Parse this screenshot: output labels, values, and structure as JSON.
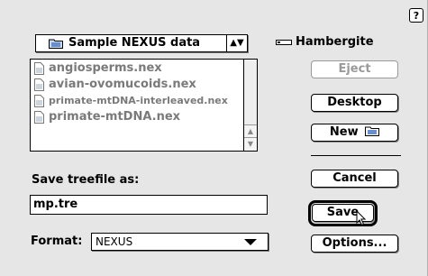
{
  "help": {
    "label": "?"
  },
  "folder_popup": {
    "name": "Sample NEXUS data",
    "arrows": "▲▼"
  },
  "volume": {
    "name": "Hambergite"
  },
  "files": [
    {
      "name": "angiosperms.nex"
    },
    {
      "name": "avian-ovomucoids.nex"
    },
    {
      "name": "primate-mtDNA-interleaved.nex"
    },
    {
      "name": "primate-mtDNA.nex"
    }
  ],
  "buttons": {
    "eject": "Eject",
    "desktop": "Desktop",
    "new": "New",
    "cancel": "Cancel",
    "save": "Save",
    "options": "Options..."
  },
  "save_as": {
    "label": "Save treefile as:",
    "value": "mp.tre"
  },
  "format": {
    "label": "Format:",
    "value": "NEXUS"
  }
}
